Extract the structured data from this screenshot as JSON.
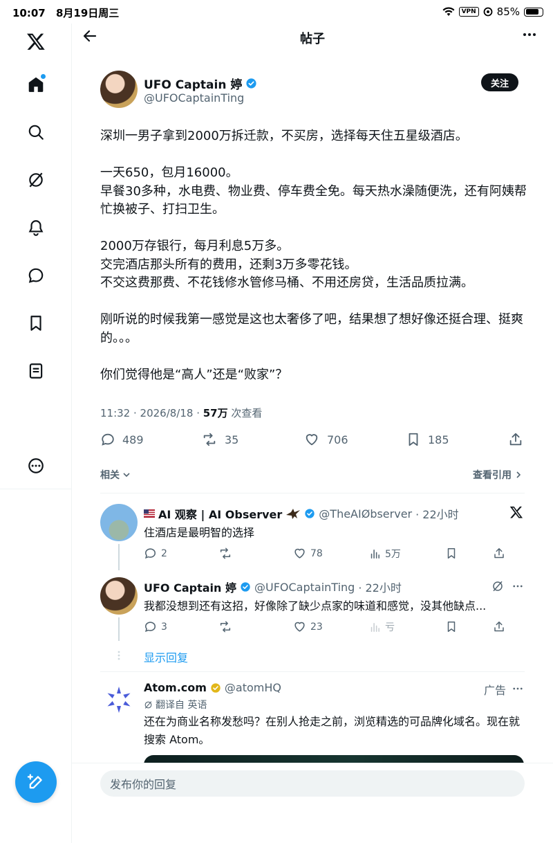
{
  "status_bar": {
    "time": "10:07",
    "date": "8月19日周三",
    "vpn": "VPN",
    "battery": "85%"
  },
  "sidebar": {
    "items": [
      {
        "name": "x-logo",
        "icon": "x-logo-icon"
      },
      {
        "name": "home",
        "icon": "home-icon"
      },
      {
        "name": "explore",
        "icon": "search-icon"
      },
      {
        "name": "grok",
        "icon": "grok-icon"
      },
      {
        "name": "notifications",
        "icon": "bell-icon"
      },
      {
        "name": "messages",
        "icon": "chat-icon"
      },
      {
        "name": "bookmarks",
        "icon": "bookmark-icon"
      },
      {
        "name": "lists",
        "icon": "list-icon"
      },
      {
        "name": "more",
        "icon": "more-circle-icon"
      }
    ],
    "compose_icon": "compose-icon"
  },
  "header": {
    "title": "帖子"
  },
  "post": {
    "author_name": "UFO Captain 婷",
    "author_handle": "@UFOCaptainTing",
    "follow_label": "关注",
    "paragraphs": [
      "深圳一男子拿到2000万拆迁款，不买房，选择每天住五星级酒店。",
      "一天650，包月16000。\n早餐30多种，水电费、物业费、停车费全免。每天热水澡随便洗，还有阿姨帮忙换被子、打扫卫生。",
      "2000万存银行，每月利息5万多。\n交完酒店那头所有的费用，还剩3万多零花钱。\n不交这费那费、不花钱修水管修马桶、不用还房贷，生活品质拉满。",
      "刚听说的时候我第一感觉是这也太奢侈了吧，结果想了想好像还挺合理、挺爽的。。。",
      "你们觉得他是“高人”还是“败家”？"
    ],
    "time": "11:32 · 2026/8/18 · ",
    "views": "57万",
    "views_suffix": " 次查看",
    "replies": "489",
    "reposts": "35",
    "likes": "706",
    "bookmarks": "185"
  },
  "related": {
    "label": "相关",
    "view_quotes": "查看引用"
  },
  "replies": [
    {
      "name": "AI 观察 | AI Observer",
      "handle": "@TheAIØbserver",
      "time": "· 22小时",
      "text": "住酒店是最明智的选择",
      "replies": "2",
      "likes": "78",
      "views": "5万"
    },
    {
      "name": "UFO Captain 婷",
      "handle": "@UFOCaptainTing",
      "time": "· 22小时",
      "text": "我都没想到还有这招，好像除了缺少点家的味道和感觉，没其他缺点...",
      "replies": "3",
      "likes": "23",
      "views": "亏"
    }
  ],
  "show_replies": "显示回复",
  "ad": {
    "name": "Atom.com",
    "handle": "@atomHQ",
    "ad_label": "广告",
    "translated": "翻译自 英语",
    "text": "还在为商业名称发愁吗？在别人抢走之前，浏览精选的可品牌化域名。现在就搜索 Atom。"
  },
  "reply_bar": {
    "placeholder": "发布你的回复"
  },
  "colors": {
    "accent": "#1d9bf0",
    "text": "#0f1419",
    "muted": "#536471"
  }
}
